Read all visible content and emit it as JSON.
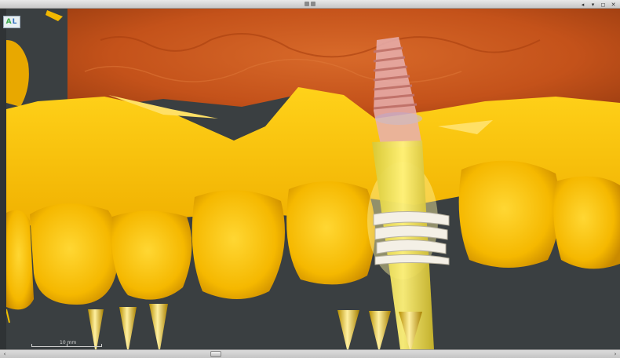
{
  "window": {
    "controls": [
      "◂",
      "▾",
      "◻",
      "✕"
    ]
  },
  "logo": {
    "a": "A",
    "l": "L"
  },
  "scale_bar": {
    "label": "10 mm"
  },
  "scrollbar": {
    "left": "‹",
    "right": "›",
    "position": 0.35
  },
  "colors": {
    "bone": "#c9541a",
    "teeth": "#f7c400",
    "implant": "#e7b3b3",
    "guide": "#efe27a",
    "background": "#3a3f41"
  },
  "icons": [
    "app-logo-icon",
    "scale-bar-icon"
  ]
}
